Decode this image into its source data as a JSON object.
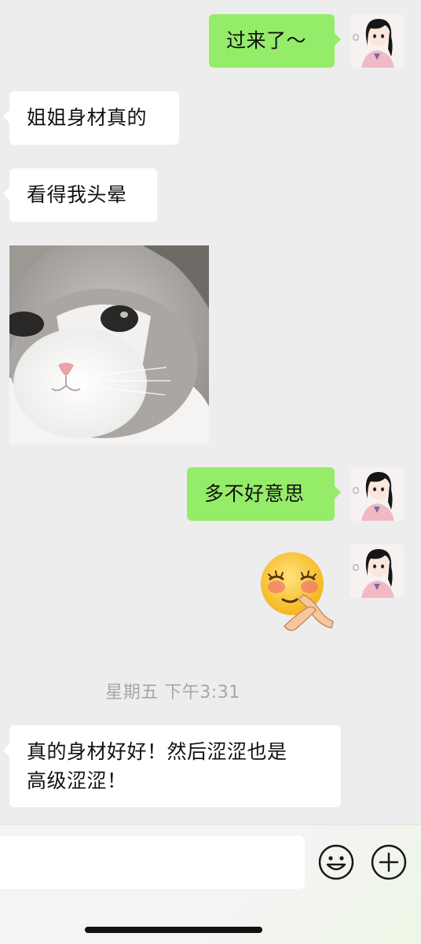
{
  "messages": [
    {
      "side": "out",
      "type": "text",
      "text": "过来了～"
    },
    {
      "side": "in",
      "type": "text",
      "text": "姐姐身材真的"
    },
    {
      "side": "in",
      "type": "text",
      "text": "看得我头晕"
    },
    {
      "side": "in",
      "type": "image",
      "icon": "cat-face-photo"
    },
    {
      "side": "out",
      "type": "text",
      "text": "多不好意思"
    },
    {
      "side": "out",
      "type": "sticker",
      "icon": "shy-blush-emoji"
    },
    {
      "type": "timestamp",
      "text": "星期五 下午3:31"
    },
    {
      "side": "in",
      "type": "text",
      "line1": "真的身材好好！然后涩涩也是",
      "line2": "高级涩涩！"
    }
  ],
  "input_bar": {
    "placeholder": "",
    "emoji_icon": "smiley-icon",
    "plus_icon": "plus-circle-icon"
  },
  "colors": {
    "background": "#ededed",
    "outgoing_bubble": "#95ec69",
    "incoming_bubble": "#ffffff",
    "timestamp_text": "#a7a7a7"
  }
}
